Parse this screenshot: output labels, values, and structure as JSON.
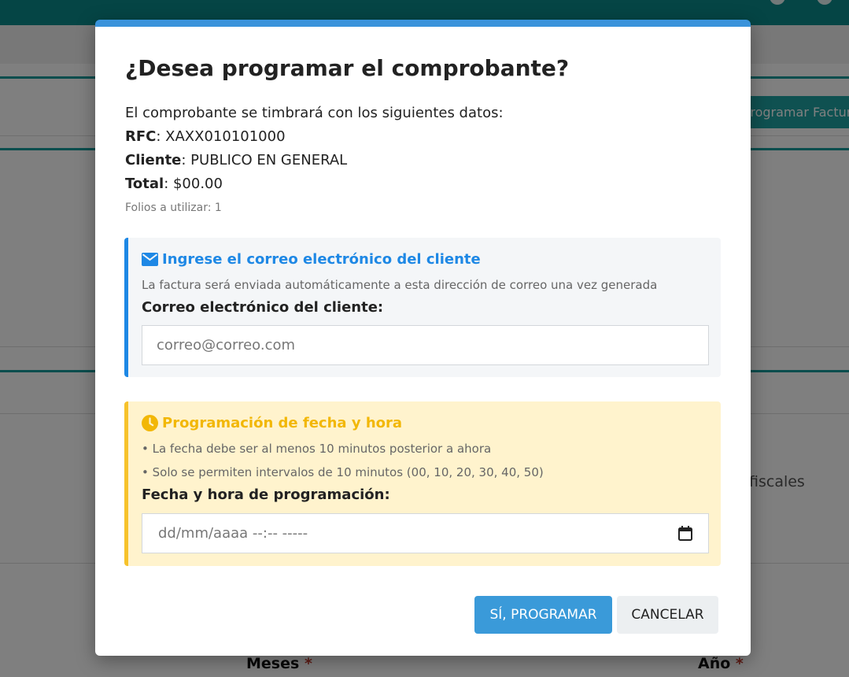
{
  "background": {
    "action_button_label": "Programar Factura",
    "side_text": "fiscales",
    "field_months_label": "Meses",
    "field_year_label": "Año",
    "required_mark": "*"
  },
  "modal": {
    "title": "¿Desea programar el comprobante?",
    "intro": "El comprobante se timbrará con los siguientes datos:",
    "rfc_label": "RFC",
    "rfc_value": ": XAXX010101000",
    "client_label": "Cliente",
    "client_value": ": PUBLICO EN GENERAL",
    "total_label": "Total",
    "total_value": ": $00.00",
    "folios_text": "Folios a utilizar: 1",
    "email_section": {
      "icon": "envelope-icon",
      "heading": "Ingrese el correo electrónico del cliente",
      "description": "La factura será enviada automáticamente a esta dirección de correo una vez generada",
      "field_label": "Correo electrónico del cliente:",
      "placeholder": "correo@correo.com",
      "value": ""
    },
    "schedule_section": {
      "icon": "clock-icon",
      "heading": "Programación de fecha y hora",
      "rule_1": "• La fecha debe ser al menos 10 minutos posterior a ahora",
      "rule_2": "• Solo se permiten intervalos de 10 minutos (00, 10, 20, 30, 40, 50)",
      "field_label": "Fecha y hora de programación:",
      "placeholder": "dd/mm/aaaa --:-- -----",
      "picker_icon": "calendar-icon"
    },
    "confirm_button": "SÍ, PROGRAMAR",
    "cancel_button": "CANCELAR"
  },
  "colors": {
    "modal_accent": "#3a93db",
    "email_accent": "#1e88e5",
    "schedule_accent": "#f7c22b",
    "primary_button": "#3a9ad9",
    "teal_theme": "#0a8a8a"
  }
}
